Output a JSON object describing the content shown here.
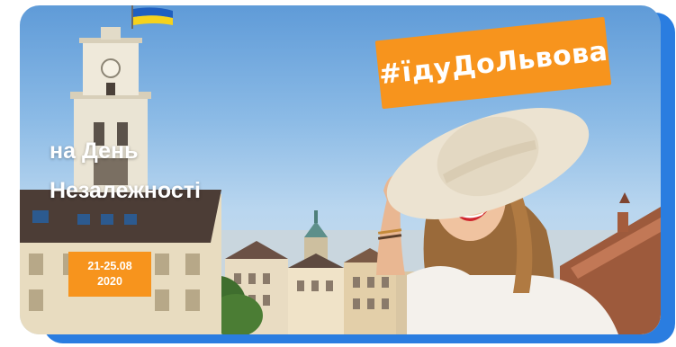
{
  "banner": {
    "hashtag": "#їдуДоЛьвова",
    "headline_line1": "на День",
    "headline_line2": "Незалежності",
    "date_range": "21-25.08",
    "year": "2020"
  },
  "colors": {
    "accent_orange": "#f7941d",
    "frame_blue": "#2a7de0",
    "sky": "#8cbbe6",
    "flag_blue": "#1f5fbf",
    "flag_yellow": "#f5d21c"
  }
}
